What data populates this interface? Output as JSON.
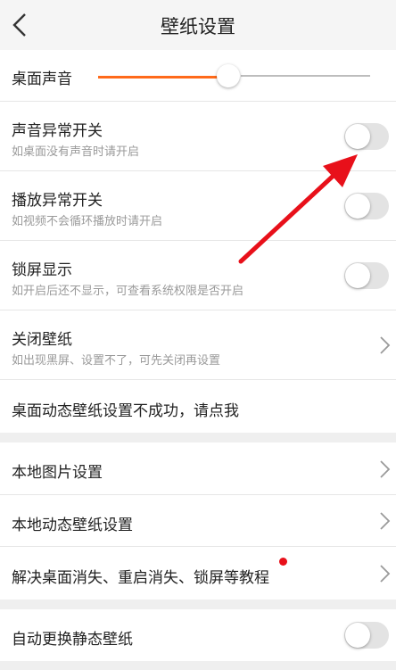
{
  "header": {
    "title": "壁纸设置",
    "back_icon": "chevron-left-icon"
  },
  "volume": {
    "label": "桌面声音",
    "level_fraction": 0.48,
    "accent_color": "#ff6a1a"
  },
  "settings": [
    {
      "label": "声音异常开关",
      "sub": "如桌面没有声音时请开启",
      "toggle_on": false
    },
    {
      "label": "播放异常开关",
      "sub": "如视频不会循环播放时请开启",
      "toggle_on": false
    },
    {
      "label": "锁屏显示",
      "sub": "如开启后还不显示，可查看系统权限是否开启",
      "toggle_on": false
    },
    {
      "label": "关闭壁纸",
      "sub": "如出现黑屏、设置不了，可先关闭再设置"
    },
    {
      "label": "桌面动态壁纸设置不成功，请点我"
    }
  ],
  "local": [
    {
      "label": "本地图片设置"
    },
    {
      "label": "本地动态壁纸设置"
    },
    {
      "label": "解决桌面消失、重启消失、锁屏等教程",
      "badge_color": "#e8101a"
    }
  ],
  "auto": {
    "label": "自动更换静态壁纸",
    "toggle_on": false
  },
  "annotation": {
    "arrow_color": "#e8101a"
  }
}
